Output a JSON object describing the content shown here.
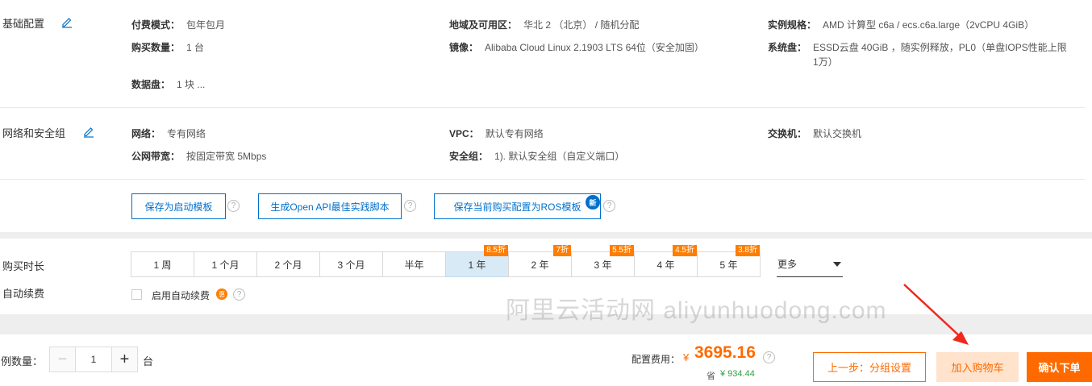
{
  "basic": {
    "title": "基础配置",
    "billing_label": "付费模式：",
    "billing_value": "包年包月",
    "region_label": "地域及可用区：",
    "region_value": "华北 2 （北京） / 随机分配",
    "spec_label": "实例规格：",
    "spec_value": "AMD 计算型 c6a / ecs.c6a.large（2vCPU 4GiB）",
    "qty_label": "购买数量：",
    "qty_value": "1 台",
    "image_label": "镜像：",
    "image_value": "Alibaba Cloud Linux 2.1903 LTS 64位（安全加固）",
    "sysdisk_label": "系统盘：",
    "sysdisk_value": "ESSD云盘 40GiB ，随实例释放，PL0（单盘IOPS性能上限1万）",
    "datadisk_label": "数据盘：",
    "datadisk_value": "1 块 ..."
  },
  "network": {
    "title": "网络和安全组",
    "net_label": "网络：",
    "net_value": "专有网络",
    "vpc_label": "VPC：",
    "vpc_value": "默认专有网络",
    "switch_label": "交换机：",
    "switch_value": "默认交换机",
    "bw_label": "公网带宽：",
    "bw_value": "按固定带宽 5Mbps",
    "sg_label": "安全组：",
    "sg_value": "1). 默认安全组（自定义端口）"
  },
  "actions": {
    "save_template": "保存为启动模板",
    "gen_openapi": "生成Open API最佳实践脚本",
    "save_ros": "保存当前购买配置为ROS模板",
    "new_badge": "新",
    "help": "?"
  },
  "duration": {
    "label": "购买时长",
    "options": [
      {
        "label": "1 周",
        "discount": ""
      },
      {
        "label": "1 个月",
        "discount": ""
      },
      {
        "label": "2 个月",
        "discount": ""
      },
      {
        "label": "3 个月",
        "discount": ""
      },
      {
        "label": "半年",
        "discount": ""
      },
      {
        "label": "1 年",
        "discount": "8.5折",
        "selected": true
      },
      {
        "label": "2 年",
        "discount": "7折"
      },
      {
        "label": "3 年",
        "discount": "5.5折"
      },
      {
        "label": "4 年",
        "discount": "4.5折"
      },
      {
        "label": "5 年",
        "discount": "3.8折"
      }
    ],
    "more": "更多"
  },
  "autorenew": {
    "label": "自动续费",
    "checkbox_label": "启用自动续费",
    "tag": "惠"
  },
  "watermark": "阿里云活动网 aliyunhuodong.com",
  "footer": {
    "qty_label": "例数量：",
    "qty_value": "1",
    "qty_unit": "台",
    "minus": "−",
    "plus": "+",
    "cost_label": "配置费用：",
    "currency": "¥",
    "cost_value": "3695.16",
    "save_label": "省",
    "save_value": "¥ 934.44",
    "prev_button": "上一步：分组设置",
    "cart_button": "加入购物车",
    "confirm_button": "确认下单"
  },
  "colors": {
    "accent_blue": "#0070cc",
    "accent_orange": "#ff6a00",
    "discount_orange": "#ff7d00",
    "selected_bg": "#d9eaf7",
    "arrow_red": "#f0281e"
  }
}
